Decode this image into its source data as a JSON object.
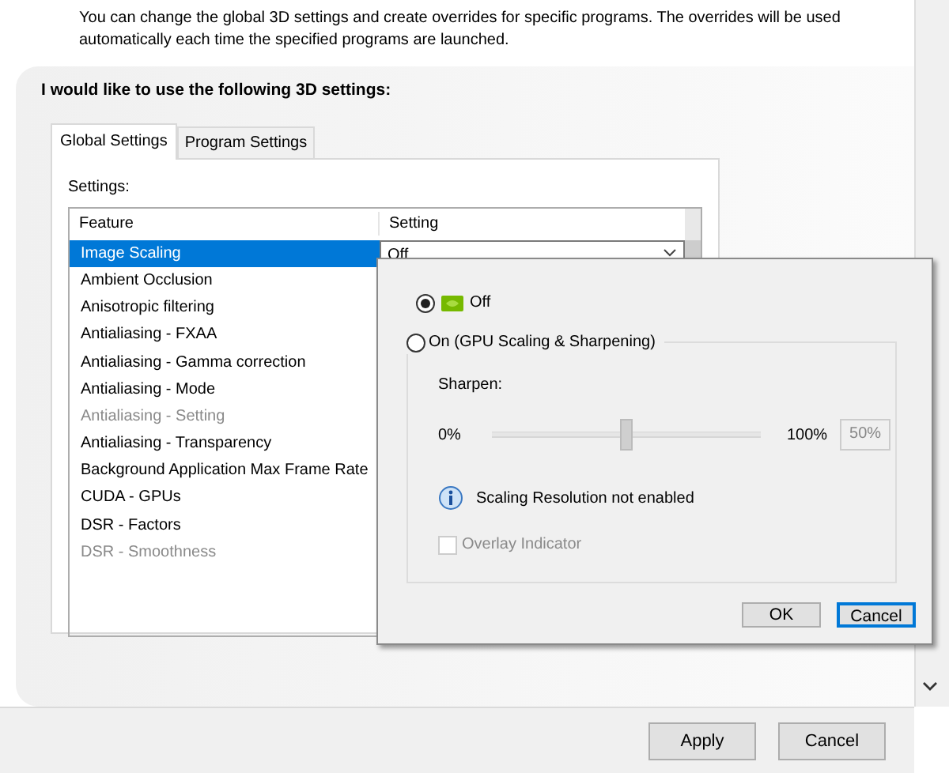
{
  "description": "You can change the global 3D settings and create overrides for specific programs. The overrides will be used automatically each time the specified programs are launched.",
  "heading": "I would like to use the following 3D settings:",
  "tabs": [
    {
      "label": "Global Settings",
      "selected": true
    },
    {
      "label": "Program Settings",
      "selected": false
    }
  ],
  "settings_label": "Settings:",
  "columns": [
    "Feature",
    "Setting"
  ],
  "rows": [
    {
      "feature": "Image Scaling",
      "setting": "Off",
      "selected": true,
      "disabled": false
    },
    {
      "feature": "Ambient Occlusion",
      "selected": false,
      "disabled": false
    },
    {
      "feature": "Anisotropic filtering",
      "selected": false,
      "disabled": false
    },
    {
      "feature": "Antialiasing - FXAA",
      "selected": false,
      "disabled": false
    },
    {
      "feature": "Antialiasing - Gamma correction",
      "selected": false,
      "disabled": false
    },
    {
      "feature": "Antialiasing - Mode",
      "selected": false,
      "disabled": false
    },
    {
      "feature": "Antialiasing - Setting",
      "selected": false,
      "disabled": true
    },
    {
      "feature": "Antialiasing - Transparency",
      "selected": false,
      "disabled": false
    },
    {
      "feature": "Background Application Max Frame Rate",
      "selected": false,
      "disabled": false
    },
    {
      "feature": "CUDA - GPUs",
      "selected": false,
      "disabled": false
    },
    {
      "feature": "DSR - Factors",
      "selected": false,
      "disabled": false
    },
    {
      "feature": "DSR - Smoothness",
      "selected": false,
      "disabled": true
    }
  ],
  "popup": {
    "options": [
      {
        "label": "Off",
        "selected": true
      },
      {
        "label": "On (GPU Scaling & Sharpening)",
        "selected": false
      }
    ],
    "sharpen_label": "Sharpen:",
    "min_label": "0%",
    "max_label": "100%",
    "level": 0.5,
    "value_box": "50%",
    "info": "Scaling Resolution not enabled",
    "overlay": {
      "label": "Overlay Indicator",
      "checked": false,
      "disabled": true
    },
    "buttons": [
      {
        "label": "OK",
        "default": false
      },
      {
        "label": "Cancel",
        "default": true
      }
    ]
  },
  "footer_buttons": [
    {
      "label": "Apply"
    },
    {
      "label": "Cancel"
    }
  ]
}
